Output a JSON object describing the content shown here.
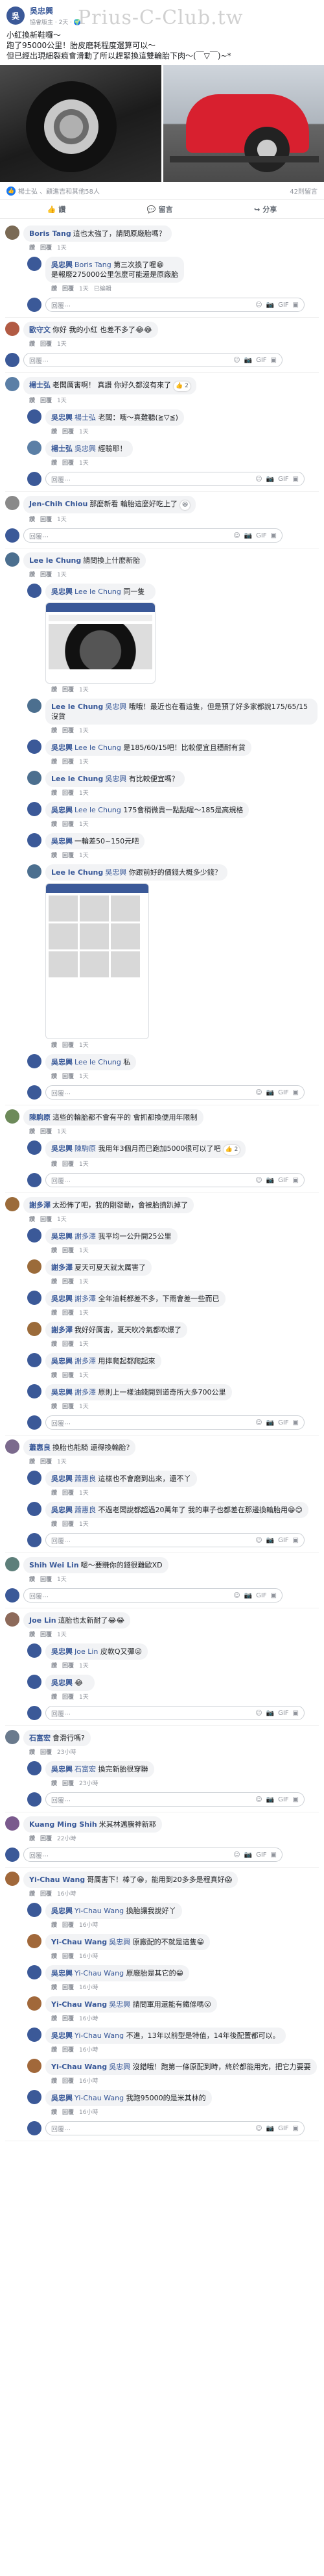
{
  "post": {
    "author": "吳忠興",
    "meta": "協會版主 · 2天 · 🌍",
    "watermark": "Prius-C-Club.tw",
    "text": "小紅換新鞋囉～\n跑了95000公里！胎皮磨耗程度還算可以～\n但已經出現細裂痕會滑動了所以趕緊換這雙輪胎下肉～(￣▽￣)~*",
    "reactions_text": "楊士弘 、顧進吉和其他58人",
    "comments_count": "42則留言",
    "actions": [
      "讚",
      "留言",
      "分享"
    ]
  },
  "ui": {
    "like": "讚",
    "reply": "回覆",
    "placeholder": "回覆⋯"
  },
  "threads": [
    {
      "comment": {
        "name": "Boris Tang",
        "text": "這也太強了，請問原廠胎嗎？",
        "time": "1天",
        "color": "#7a6a55"
      },
      "replies": [
        {
          "name": "吳忠興",
          "tag": "Boris Tang",
          "text": "第三次換了喔😁\n是報廢275000公里怎麼可能還是原廠胎",
          "time": "1天",
          "extra": "已編輯",
          "color": "#3b5998"
        }
      ]
    },
    {
      "comment": {
        "name": "歐守文",
        "text": "你好 我的小紅 也差不多了😂😂",
        "time": "1天",
        "color": "#b25b44"
      },
      "replies": []
    },
    {
      "comment": {
        "name": "楊士弘",
        "text": "老闆厲害啊！ 真讚 你好久都沒有來了",
        "time": "1天",
        "react": "👍 2",
        "color": "#5b7fa6"
      },
      "replies": [
        {
          "name": "吳忠興",
          "tag": "楊士弘",
          "text": "老闆：哦～真難聽(≧▽≦)",
          "time": "1天",
          "color": "#3b5998"
        },
        {
          "name": "楊士弘",
          "tag": "吳忠興",
          "text": "經驗耶！",
          "time": "1天",
          "color": "#5b7fa6"
        }
      ]
    },
    {
      "comment": {
        "name": "Jen-Chih Chiou",
        "text": "那麼新看 輪胎這麼好吃上了",
        "time": "1天",
        "react": "😆",
        "color": "#8a8a8a"
      },
      "replies": []
    },
    {
      "comment": {
        "name": "Lee le Chung",
        "text": "請問換上什麼新胎",
        "time": "1天",
        "color": "#4c6f8f"
      },
      "replies": [
        {
          "name": "吳忠興",
          "tag": "Lee le Chung",
          "text": "同一隻",
          "time": "1天",
          "color": "#3b5998",
          "shot": "phone1"
        },
        {
          "name": "Lee le Chung",
          "tag": "吳忠興",
          "text": "哦哦！最近也在看這隻，但是預了好多家都說175/65/15沒貨",
          "time": "1天",
          "color": "#4c6f8f"
        },
        {
          "name": "吳忠興",
          "tag": "Lee le Chung",
          "text": "是185/60/15吧！比較便宜且穩耐有貨",
          "time": "1天",
          "color": "#3b5998"
        },
        {
          "name": "Lee le Chung",
          "tag": "吳忠興",
          "text": "有比較便宜嗎？",
          "time": "1天",
          "color": "#4c6f8f"
        },
        {
          "name": "吳忠興",
          "tag": "Lee le Chung",
          "text": "175會稍微貴一點點喔～185是高規格",
          "time": "1天",
          "color": "#3b5998"
        },
        {
          "name": "吳忠興",
          "tag": "",
          "text": "一輪差50~150元吧",
          "time": "1天",
          "color": "#3b5998"
        },
        {
          "name": "Lee le Chung",
          "tag": "吳忠興",
          "text": "你跟前好的價錢大概多少錢？",
          "time": "1天",
          "color": "#4c6f8f",
          "shot": "phone2"
        },
        {
          "name": "吳忠興",
          "tag": "Lee le Chung",
          "text": "私",
          "time": "1天",
          "color": "#3b5998"
        }
      ]
    },
    {
      "comment": {
        "name": "陳駒原",
        "text": "這些的輪胎都不會有平的 會抓都換便用年限制",
        "time": "1天",
        "color": "#6d8a5a"
      },
      "replies": [
        {
          "name": "吳忠興",
          "tag": "陳駒原",
          "text": "我用年3個月而已跑加5000很可以了吧",
          "time": "1天",
          "react": "👍 2",
          "color": "#3b5998"
        }
      ]
    },
    {
      "comment": {
        "name": "謝多澤",
        "text": "太恐怖了吧，我的剛發動，會被胎擠趴掉了",
        "time": "1天",
        "color": "#9b6b3a"
      },
      "replies": [
        {
          "name": "吳忠興",
          "tag": "謝多澤",
          "text": "我平均一公升開25公里",
          "time": "1天",
          "color": "#3b5998"
        },
        {
          "name": "謝多澤",
          "tag": "",
          "text": "夏天可夏天就太厲害了",
          "time": "1天",
          "color": "#9b6b3a"
        },
        {
          "name": "吳忠興",
          "tag": "謝多澤",
          "text": "全年油耗都差不多，下雨會差一些而已",
          "time": "1天",
          "color": "#3b5998"
        },
        {
          "name": "謝多澤",
          "tag": "",
          "text": "我好好厲害，夏天吹冷氣都吹爆了",
          "time": "1天",
          "color": "#9b6b3a"
        },
        {
          "name": "吳忠興",
          "tag": "謝多澤",
          "text": "用摔爬起都爬起來",
          "time": "1天",
          "color": "#3b5998"
        },
        {
          "name": "吳忠興",
          "tag": "謝多澤",
          "text": "原則上一樣油錢開到道奇所大多700公里",
          "time": "1天",
          "color": "#3b5998"
        }
      ]
    },
    {
      "comment": {
        "name": "蕭惠良",
        "text": "換胎也能騎 還得換輪胎?",
        "time": "1天",
        "color": "#7b6a8d"
      },
      "replies": [
        {
          "name": "吳忠興",
          "tag": "蕭惠良",
          "text": "這樣也不會磨到出來，還不丫",
          "time": "1天",
          "color": "#3b5998"
        },
        {
          "name": "吳忠興",
          "tag": "蕭惠良",
          "text": "不過老闆說都超過20萬年了 我的車子也都差在那邊換輪胎用😁😊",
          "time": "1天",
          "color": "#3b5998"
        }
      ]
    },
    {
      "comment": {
        "name": "Shih Wei Lin",
        "text": "嗯～要賺你的錢很難歐XD",
        "time": "1天",
        "color": "#5d7f7a"
      },
      "replies": []
    },
    {
      "comment": {
        "name": "Joe Lin",
        "text": "這胎也太新耐了😂😂",
        "time": "1天",
        "color": "#8d6a5a"
      },
      "replies": [
        {
          "name": "吳忠興",
          "tag": "Joe Lin",
          "text": "皮軟Q又彈😜",
          "time": "1天",
          "color": "#3b5998"
        },
        {
          "name": "吳忠興",
          "tag": "",
          "text": "😂",
          "time": "1天",
          "color": "#3b5998"
        }
      ]
    },
    {
      "comment": {
        "name": "石富宏",
        "text": "會滑行嗎?",
        "time": "23小時",
        "color": "#6a7a8d"
      },
      "replies": [
        {
          "name": "吳忠興",
          "tag": "石富宏",
          "text": "換完新胎很穿聯",
          "time": "23小時",
          "color": "#3b5998"
        }
      ]
    },
    {
      "comment": {
        "name": "Kuang Ming Shih",
        "text": "米其林邁騰神新耶",
        "time": "22小時",
        "color": "#7a5a8d"
      },
      "replies": []
    },
    {
      "comment": {
        "name": "Yi-Chau Wang",
        "text": "哥厲害下！棒了😁，能用到20多多是程真好😱",
        "time": "16小時",
        "color": "#a1683a"
      },
      "replies": [
        {
          "name": "吳忠興",
          "tag": "Yi-Chau Wang",
          "text": "換胎讓我說好丫",
          "time": "16小時",
          "color": "#3b5998"
        },
        {
          "name": "Yi-Chau Wang",
          "tag": "吳忠興",
          "text": "原廠配的不就是這隻😁",
          "time": "16小時",
          "color": "#a1683a"
        },
        {
          "name": "吳忠興",
          "tag": "Yi-Chau Wang",
          "text": "原廠胎是其它的😁",
          "time": "16小時",
          "color": "#3b5998"
        },
        {
          "name": "Yi-Chau Wang",
          "tag": "吳忠興",
          "text": "請問軍用還能有鐵條嗎😮",
          "time": "16小時",
          "color": "#a1683a"
        },
        {
          "name": "吳忠興",
          "tag": "Yi-Chau Wang",
          "text": "不進，13年以前型是特值，14年後配置都可以。",
          "time": "16小時",
          "color": "#3b5998"
        },
        {
          "name": "Yi-Chau Wang",
          "tag": "吳忠興",
          "text": "沒錯哦！跑第一條原配到時，終於都能用完，把它力要要",
          "time": "16小時",
          "color": "#a1683a"
        },
        {
          "name": "吳忠興",
          "tag": "Yi-Chau Wang",
          "text": "我跑95000的是米其林的",
          "time": "16小時",
          "color": "#3b5998"
        }
      ]
    }
  ]
}
